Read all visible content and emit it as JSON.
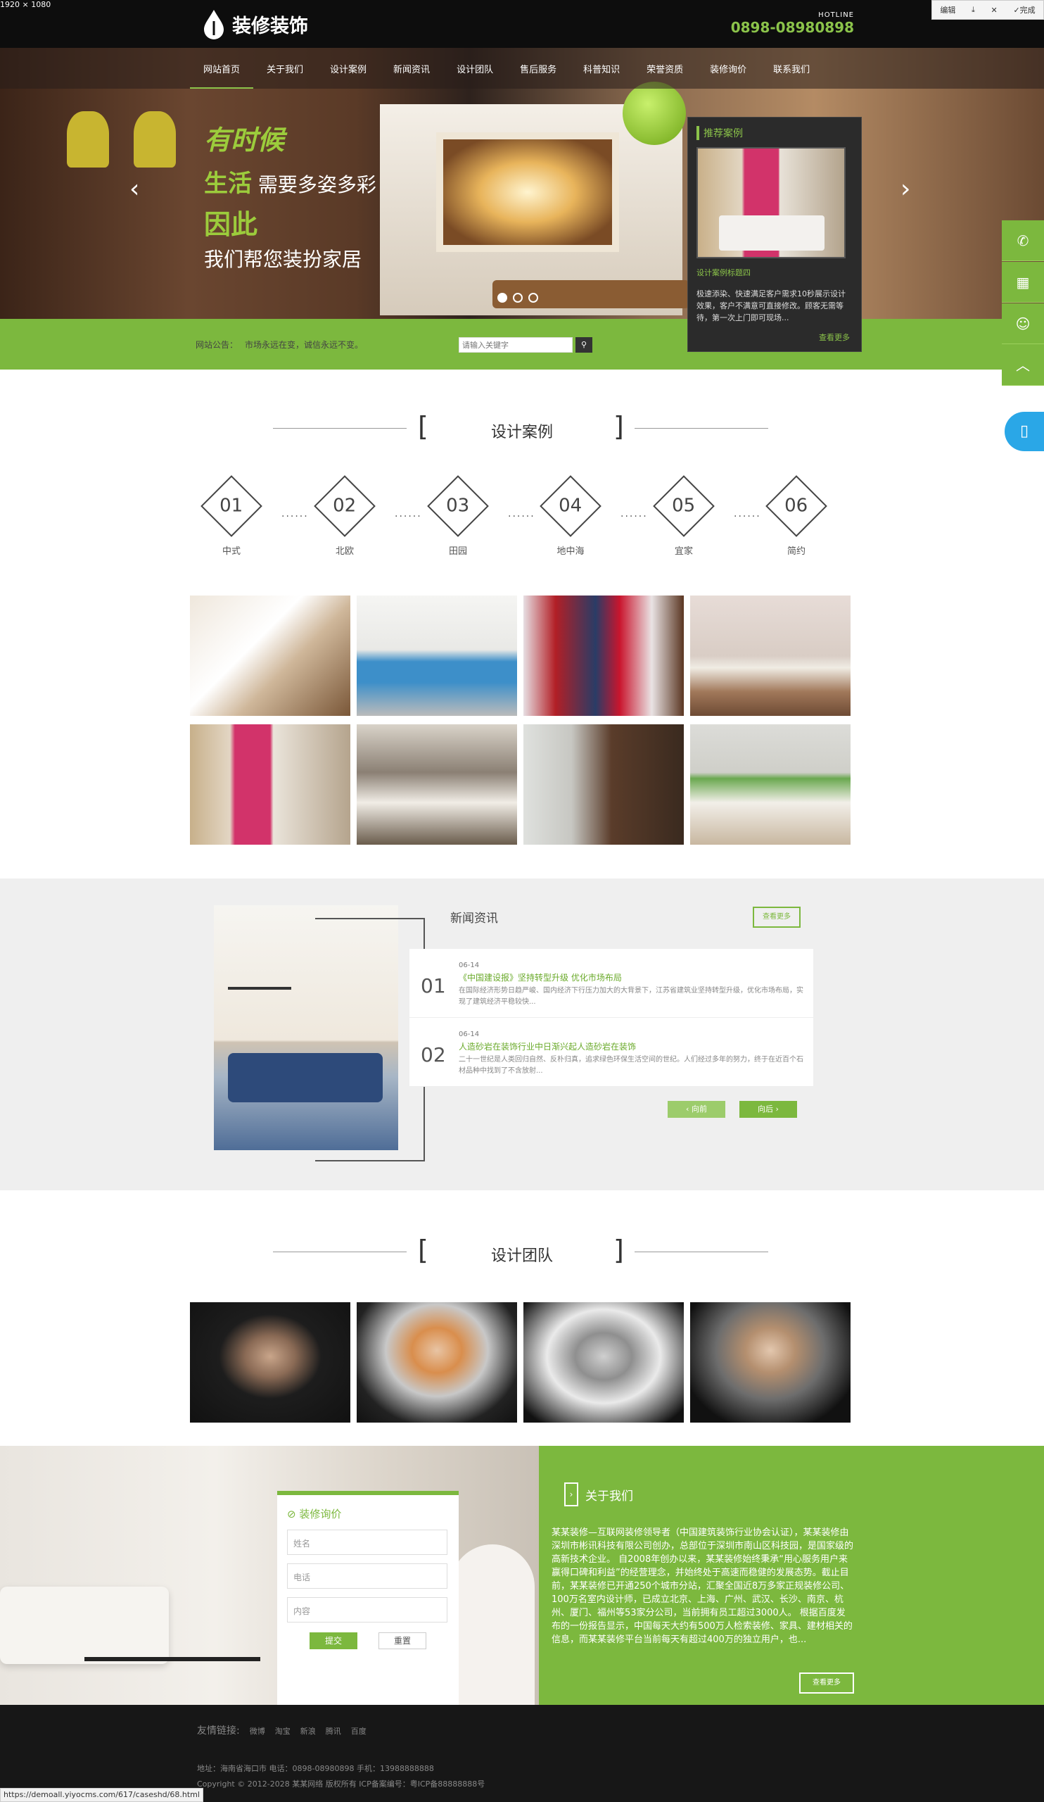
{
  "screen": {
    "dim_label": "1920 × 1080"
  },
  "toolbar": {
    "edit": "编辑",
    "done": "完成"
  },
  "header": {
    "logo": "装修装饰",
    "hotline_label": "HOTLINE",
    "hotline": "0898-08980898"
  },
  "nav": [
    "网站首页",
    "关于我们",
    "设计案例",
    "新闻资讯",
    "设计团队",
    "售后服务",
    "科普知识",
    "荣誉资质",
    "装修询价",
    "联系我们"
  ],
  "hero": {
    "s1": "有时候",
    "s2a": "生活",
    "s2b": "需要多姿多彩",
    "s3": "因此",
    "s4": "我们帮您装扮家居"
  },
  "rec": {
    "title": "推荐案例",
    "image_title": "设计案例标题四",
    "desc": "极速添染、快速满足客户需求10秒展示设计效果，客户不满意可直接修改。顾客无需等待，第一次上门即可现场...",
    "more": "查看更多"
  },
  "notice": {
    "label": "网站公告：",
    "text": "市场永远在变，诚信永远不变。",
    "search_placeholder": "请输入关键字"
  },
  "cases": {
    "title": "设计案例",
    "styles": [
      {
        "no": "01",
        "name": "中式"
      },
      {
        "no": "02",
        "name": "北欧"
      },
      {
        "no": "03",
        "name": "田园"
      },
      {
        "no": "04",
        "name": "地中海"
      },
      {
        "no": "05",
        "name": "宜家"
      },
      {
        "no": "06",
        "name": "简约"
      }
    ]
  },
  "news": {
    "title": "新闻资讯",
    "more": "查看更多",
    "items": [
      {
        "no": "01",
        "date": "06-14",
        "headline": "《中国建设报》坚持转型升级 优化市场布局",
        "text": "在国际经济形势日趋严峻、国内经济下行压力加大的大背景下，江苏省建筑业坚持转型升级，优化市场布局，实现了建筑经济平稳较快..."
      },
      {
        "no": "02",
        "date": "06-14",
        "headline": "人造砂岩在装饰行业中日渐兴起人造砂岩在装饰",
        "text": "二十一世纪是人类回归自然、反朴归真，追求绿色环保生活空间的世纪。人们经过多年的努力，终于在近百个石材品种中找到了不含放射..."
      }
    ],
    "prev": "向前",
    "next": "向后"
  },
  "team": {
    "title": "设计团队"
  },
  "form": {
    "title": "装修询价",
    "name": "姓名",
    "phone": "电话",
    "content": "内容",
    "submit": "提交",
    "reset": "重置"
  },
  "about": {
    "title": "关于我们",
    "text": "某某装修—互联网装修领导者（中国建筑装饰行业协会认证），某某装修由深圳市彬讯科技有限公司创办，总部位于深圳市南山区科技园，是国家级的高新技术企业。 自2008年创办以来，某某装修始终秉承“用心服务用户来赢得口碑和利益”的经营理念，并始终处于高速而稳健的发展态势。截止目前，某某装修已开通250个城市分站，汇聚全国近8万多家正规装修公司、100万名室内设计师，已成立北京、上海、广州、武汉、长沙、南京、杭州、厦门、福州等53家分公司，当前拥有员工超过3000人。 根据百度发布的一份报告显示，中国每天大约有500万人检索装修、家具、建材相关的信息，而某某装修平台当前每天有超过400万的独立用户，也...",
    "more": "查看更多"
  },
  "footer": {
    "links_label": "友情链接:",
    "links": [
      "微博",
      "淘宝",
      "新浪",
      "腾讯",
      "百度"
    ],
    "line1": "地址：海南省海口市   电话：0898-08980898   手机：13988888888",
    "line2": "Copyright © 2012-2028 某某网络 版权所有     ICP备案编号：粤ICP备88888888号"
  },
  "status": {
    "url": "https://demoall.yiyocms.com/617/caseshd/68.html"
  },
  "colors": {
    "accent": "#7cb83e",
    "dark": "#0d0d0d"
  }
}
